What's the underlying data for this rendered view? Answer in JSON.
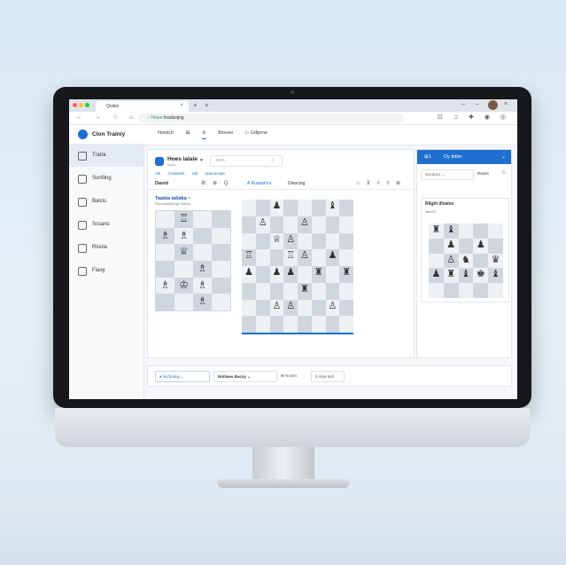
{
  "browser": {
    "tab_title": "Qoiles",
    "tab_close": "×",
    "tab_plus": "+",
    "window_controls": "– – ○ ×",
    "nav_buttons": "← → ○ ⌂",
    "url_prefix": "○ Hoiuo",
    "url": "foadasijng",
    "extensions": "⊡ ♫ ✚ ◉ ◎"
  },
  "app": {
    "name": "Clon Trainiy",
    "toolbar": [
      "Nowlch",
      "⊞",
      "⑨",
      "Biouee",
      "▷ Gdipme"
    ]
  },
  "sidebar": [
    {
      "label": "Trarla",
      "active": true
    },
    {
      "label": "Sunfiing",
      "active": false
    },
    {
      "label": "Balcis",
      "active": false
    },
    {
      "label": "Scsans",
      "active": false
    },
    {
      "label": "Rloola",
      "active": false
    },
    {
      "label": "Fiaoy",
      "active": false
    }
  ],
  "panel": {
    "title": "Hoes lalale ⌄",
    "subtitle": "biplid",
    "search_placeholder": "bem",
    "search_icon": "○",
    "subtabs": [
      "Aik",
      "Crosdosk",
      "Sdi",
      "Apaoinnale"
    ],
    "row_left": "David",
    "row_icons_left": "⚙ ⊕ Q",
    "row_mid": "A Ruaionhrs",
    "row_right": "Dinocing",
    "row_icons_right": "⌂ ⊻ ◊ ◊ ⊕"
  },
  "subcard": {
    "title": "Taabia taliaka ~",
    "subtitle": "Ferm tmlllqll Age 2cfelc)"
  },
  "right_panel": {
    "button_a": "⊞1",
    "button_b": "Dy ddler",
    "button_caret": "⌄",
    "select": "Sucdacs ⌄",
    "select2": "Rases",
    "bell": "⌂",
    "card_title": "Rlighl dlvalse",
    "card_sub": "Nev23"
  },
  "bottom": {
    "field1": "♦ hur'tnoley ⌄",
    "field2": "Nottwes Bacsy ⌄",
    "action1": "⊞ Noxen",
    "action2": "⟫ Aloe txrk"
  },
  "colors": {
    "accent": "#1e6fd0",
    "light_sq": "#eef1f4",
    "dark_sq": "#cfd6de"
  }
}
